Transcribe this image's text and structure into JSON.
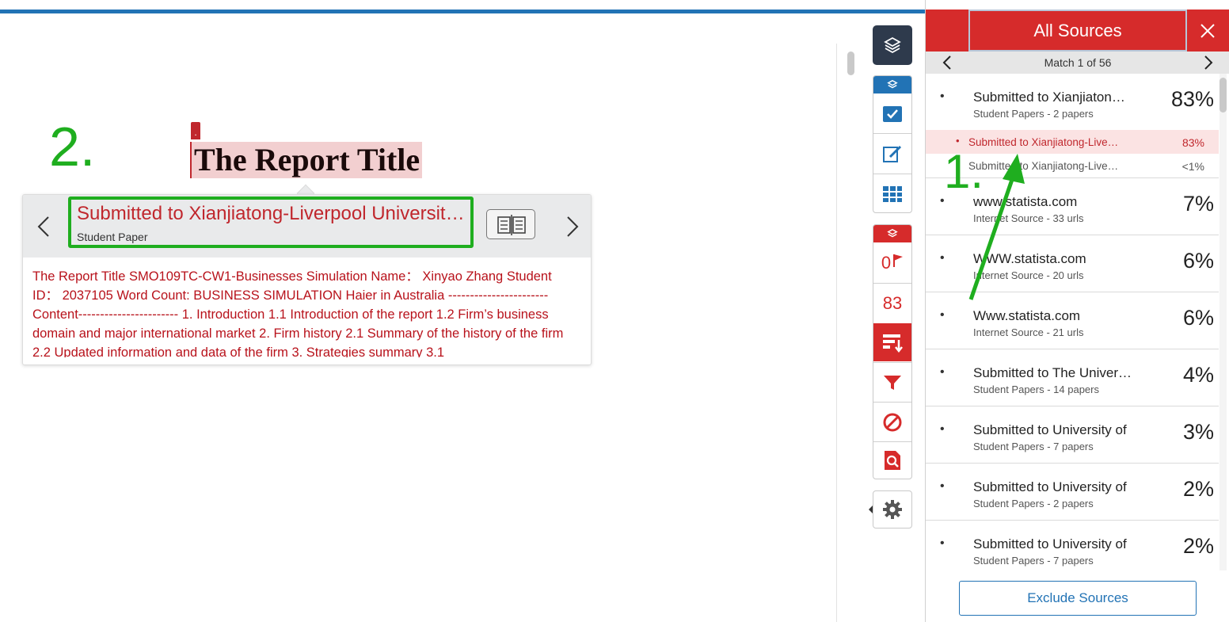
{
  "annotations": {
    "step_2": "2.",
    "step_1": "1."
  },
  "document": {
    "marker": ".",
    "title": "The Report Title"
  },
  "popup": {
    "source_title": "Submitted to Xianjiatong-Liverpool University ...",
    "source_type": "Student Paper",
    "excerpt": "The Report Title SMO109TC-CW1-Businesses Simulation Name： Xinyao Zhang Student ID： 2037105 Word Count: BUSINESS SIMULATION Haier in Australia -----------------------Content----------------------- 1. Introduction 1.1 Introduction of the report 1.2 Firm’s business domain and major international market 2. Firm history 2.1 Summary of the history of the firm 2.2 Updated information and data of the firm 3. Strategies summary 3.1"
  },
  "toolbar": {
    "flag_count": "0",
    "match_count": "83"
  },
  "sidebar": {
    "title": "All Sources",
    "nav_label": "Match 1 of 56",
    "sources": [
      {
        "name": "Submitted to Xianjiatong-Liverpool University",
        "sub": "Student Papers - 2 papers",
        "pct": "83%"
      },
      {
        "name": "www.statista.com",
        "sub": "Internet Source - 33 urls",
        "pct": "7%"
      },
      {
        "name": "WWW.statista.com",
        "sub": "Internet Source - 20 urls",
        "pct": "6%"
      },
      {
        "name": "Www.statista.com",
        "sub": "Internet Source - 21 urls",
        "pct": "6%"
      },
      {
        "name": "Submitted to The University",
        "sub": "Student Papers - 14 papers",
        "pct": "4%"
      },
      {
        "name": "Submitted to University of",
        "sub": "Student Papers - 7 papers",
        "pct": "3%"
      },
      {
        "name": "Submitted to University of",
        "sub": "Student Papers - 2 papers",
        "pct": "2%"
      },
      {
        "name": "Submitted to University of",
        "sub": "Student Papers - 7 papers",
        "pct": "2%"
      }
    ],
    "subsources": [
      {
        "name": "Submitted to Xianjiatong-Liverpool University",
        "pct": "83%"
      },
      {
        "name": "Submitted to Xianjiatong-Liverpool University",
        "pct": "<1%"
      }
    ],
    "exclude_label": "Exclude Sources"
  },
  "colors": {
    "accent_red": "#d62b2b",
    "accent_blue": "#2273b5",
    "annotation_green": "#1fae1f"
  }
}
